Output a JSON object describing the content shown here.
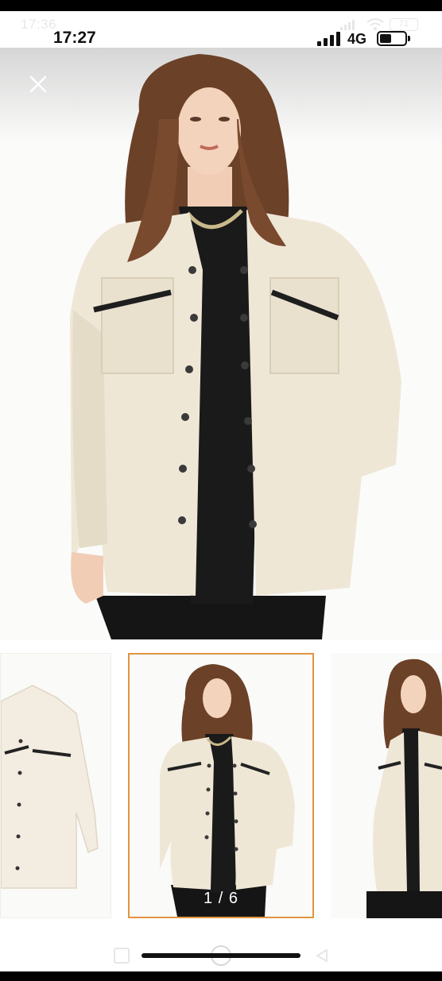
{
  "outer_status": {
    "time": "17:36",
    "battery": "71"
  },
  "status_bar": {
    "time": "17:27",
    "network": "4G"
  },
  "gallery": {
    "counter": "1 / 6",
    "current_index": 1,
    "total": 6,
    "selected_border_color": "#e29440",
    "thumbnails": [
      {
        "name": "flat-lay"
      },
      {
        "name": "front-view"
      },
      {
        "name": "side-view"
      }
    ]
  },
  "icons": {
    "close": "close-icon",
    "home": "home-bar-icon"
  },
  "product": {
    "jacket_color": "#efe7d6"
  }
}
